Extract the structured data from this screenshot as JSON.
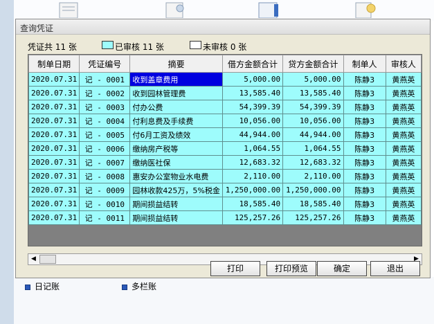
{
  "dialog": {
    "title": "查询凭证"
  },
  "summary": {
    "total": "凭证共 11 张",
    "reviewed": "已审核 11 张",
    "unreviewed": "未审核 0 张",
    "reviewed_color": "#9efcfc",
    "unreviewed_color": "#ffffff"
  },
  "table": {
    "headers": [
      "制单日期",
      "凭证编号",
      "摘要",
      "借方金额合计",
      "贷方金额合计",
      "制单人",
      "审核人"
    ],
    "rows": [
      {
        "date": "2020.07.31",
        "no": "记 - 0001",
        "summary": "收到盖章费用",
        "debit": "5,000.00",
        "credit": "5,000.00",
        "maker": "陈静3",
        "reviewer": "黄燕英"
      },
      {
        "date": "2020.07.31",
        "no": "记 - 0002",
        "summary": "收到园林管理费",
        "debit": "13,585.40",
        "credit": "13,585.40",
        "maker": "陈静3",
        "reviewer": "黄燕英"
      },
      {
        "date": "2020.07.31",
        "no": "记 - 0003",
        "summary": "付办公费",
        "debit": "54,399.39",
        "credit": "54,399.39",
        "maker": "陈静3",
        "reviewer": "黄燕英"
      },
      {
        "date": "2020.07.31",
        "no": "记 - 0004",
        "summary": "付利息费及手续费",
        "debit": "10,056.00",
        "credit": "10,056.00",
        "maker": "陈静3",
        "reviewer": "黄燕英"
      },
      {
        "date": "2020.07.31",
        "no": "记 - 0005",
        "summary": "付6月工资及绩效",
        "debit": "44,944.00",
        "credit": "44,944.00",
        "maker": "陈静3",
        "reviewer": "黄燕英"
      },
      {
        "date": "2020.07.31",
        "no": "记 - 0006",
        "summary": "缴纳房产税等",
        "debit": "1,064.55",
        "credit": "1,064.55",
        "maker": "陈静3",
        "reviewer": "黄燕英"
      },
      {
        "date": "2020.07.31",
        "no": "记 - 0007",
        "summary": "缴纳医社保",
        "debit": "12,683.32",
        "credit": "12,683.32",
        "maker": "陈静3",
        "reviewer": "黄燕英"
      },
      {
        "date": "2020.07.31",
        "no": "记 - 0008",
        "summary": "惠安办公室物业水电费",
        "debit": "2,110.00",
        "credit": "2,110.00",
        "maker": "陈静3",
        "reviewer": "黄燕英"
      },
      {
        "date": "2020.07.31",
        "no": "记 - 0009",
        "summary": "园林收款425万，5%税金",
        "debit": "1,250,000.00",
        "credit": "1,250,000.00",
        "maker": "陈静3",
        "reviewer": "黄燕英"
      },
      {
        "date": "2020.07.31",
        "no": "记 - 0010",
        "summary": "期间损益结转",
        "debit": "18,585.40",
        "credit": "18,585.40",
        "maker": "陈静3",
        "reviewer": "黄燕英"
      },
      {
        "date": "2020.07.31",
        "no": "记 - 0011",
        "summary": "期间损益结转",
        "debit": "125,257.26",
        "credit": "125,257.26",
        "maker": "陈静3",
        "reviewer": "黄燕英"
      }
    ]
  },
  "buttons": {
    "print": "打印",
    "preview": "打印预览",
    "ok": "确定",
    "exit": "退出"
  },
  "bottom": {
    "journal": "日记账",
    "multi_column": "多栏账"
  }
}
